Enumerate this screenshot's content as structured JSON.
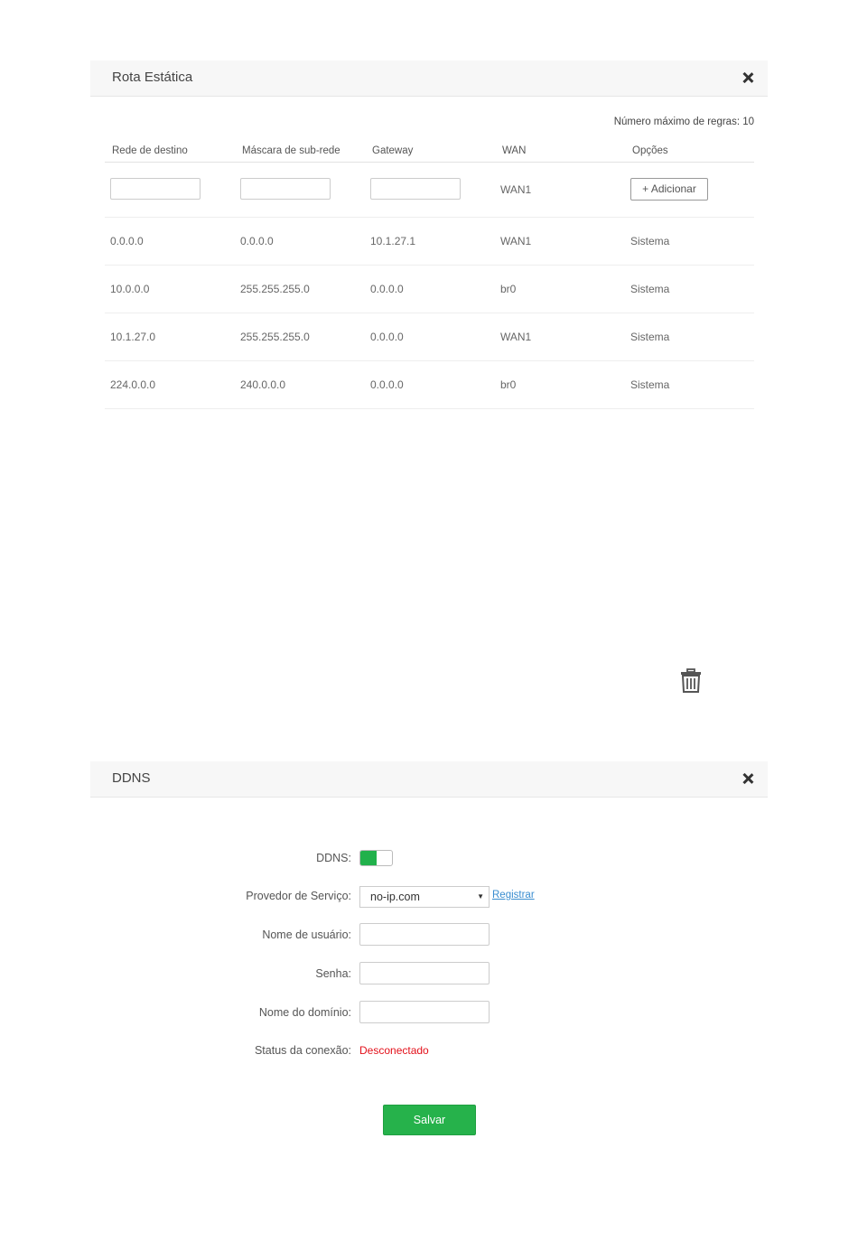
{
  "static_route": {
    "title": "Rota Estática",
    "max_rules_label": "Número máximo de regras: 10",
    "columns": [
      "Rede de destino",
      "Máscara de sub-rede",
      "Gateway",
      "WAN",
      "Opções"
    ],
    "new_row": {
      "destination_value": "",
      "mask_value": "",
      "gateway_value": "",
      "wan": "WAN1",
      "add_button": "+ Adicionar"
    },
    "rows": [
      {
        "destination": "0.0.0.0",
        "mask": "0.0.0.0",
        "gateway": "10.1.27.1",
        "wan": "WAN1",
        "option": "Sistema"
      },
      {
        "destination": "10.0.0.0",
        "mask": "255.255.255.0",
        "gateway": "0.0.0.0",
        "wan": "br0",
        "option": "Sistema"
      },
      {
        "destination": "10.1.27.0",
        "mask": "255.255.255.0",
        "gateway": "0.0.0.0",
        "wan": "WAN1",
        "option": "Sistema"
      },
      {
        "destination": "224.0.0.0",
        "mask": "240.0.0.0",
        "gateway": "0.0.0.0",
        "wan": "br0",
        "option": "Sistema"
      }
    ]
  },
  "icons": {
    "close": "close-icon",
    "delete": "trash-icon"
  },
  "ddns": {
    "title": "DDNS",
    "enable_label": "DDNS:",
    "enabled": true,
    "provider_label": "Provedor de Serviço:",
    "provider_value": "no-ip.com",
    "register_link": "Registrar",
    "username_label": "Nome de usuário:",
    "username_value": "",
    "password_label": "Senha:",
    "password_value": "",
    "domain_label": "Nome do domínio:",
    "domain_value": "",
    "status_label": "Status da conexão:",
    "status_value": "Desconectado",
    "save_button": "Salvar"
  },
  "colors": {
    "accent_green": "#26b24b",
    "status_red": "#e3101a",
    "link_blue": "#3a8dd0",
    "header_bg": "#f7f7f7"
  }
}
